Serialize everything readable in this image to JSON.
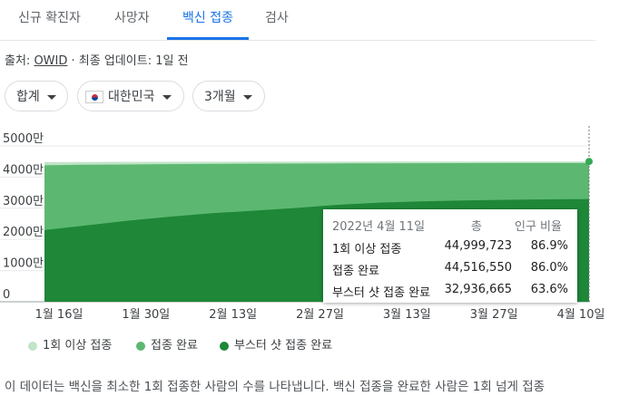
{
  "tabs": [
    {
      "label": "신규 확진자",
      "active": false
    },
    {
      "label": "사망자",
      "active": false
    },
    {
      "label": "백신 접종",
      "active": true
    },
    {
      "label": "검사",
      "active": false
    }
  ],
  "source": {
    "prefix": "출처:",
    "name": "OWID",
    "suffix": "· 최종 업데이트: 1일 전"
  },
  "filters": {
    "total": "합계",
    "country": "대한민국",
    "period": "3개월"
  },
  "chart_data": {
    "type": "area",
    "y_ticks": [
      "5000만",
      "4000만",
      "3000만",
      "2000만",
      "1000만",
      "0"
    ],
    "ylim": [
      0,
      50000000
    ],
    "x_tick_labels": [
      "1월 16일",
      "1월 30일",
      "2월 13일",
      "2월 27일",
      "3월 13일",
      "3월 27일",
      "4월 10일"
    ],
    "x": [
      "1월 12일",
      "1월 16일",
      "1월 23일",
      "1월 30일",
      "2월 6일",
      "2월 13일",
      "2월 20일",
      "2월 27일",
      "3월 6일",
      "3월 13일",
      "3월 20일",
      "3월 27일",
      "4월 3일",
      "4월 11일"
    ],
    "series": [
      {
        "name": "1회 이상 접종",
        "color": "#c1e4c8",
        "values": [
          44800000,
          44850000,
          44880000,
          44900000,
          44920000,
          44940000,
          44955000,
          44965000,
          44975000,
          44982000,
          44988000,
          44993000,
          44997000,
          44999723
        ]
      },
      {
        "name": "접종 완료",
        "color": "#5cb870",
        "values": [
          43800000,
          43950000,
          44050000,
          44150000,
          44230000,
          44290000,
          44340000,
          44380000,
          44420000,
          44450000,
          44475000,
          44495000,
          44508000,
          44516550
        ]
      },
      {
        "name": "부스터 샷 접종 완료",
        "color": "#1e8738",
        "values": [
          23000000,
          24500000,
          26000000,
          27300000,
          28400000,
          29200000,
          30100000,
          31100000,
          31800000,
          32200000,
          32500000,
          32700000,
          32850000,
          32936665
        ]
      }
    ]
  },
  "tooltip": {
    "date": "2022년 4월 11일",
    "col_total": "총",
    "col_ratio": "인구 비율",
    "rows": [
      {
        "label": "1회 이상 접종",
        "value": "44,999,723",
        "ratio": "86.9%"
      },
      {
        "label": "접종 완료",
        "value": "44,516,550",
        "ratio": "86.0%"
      },
      {
        "label": "부스터 샷 접종 완료",
        "value": "32,936,665",
        "ratio": "63.6%"
      }
    ]
  },
  "legend": [
    "1회 이상 접종",
    "접종 완료",
    "부스터 샷 접종 완료"
  ],
  "footer": "이 데이터는 백신을 최소한 1회 접종한 사람의 수를 나타냅니다. 백신 접종을 완료한 사람은 1회 넘게 접종"
}
